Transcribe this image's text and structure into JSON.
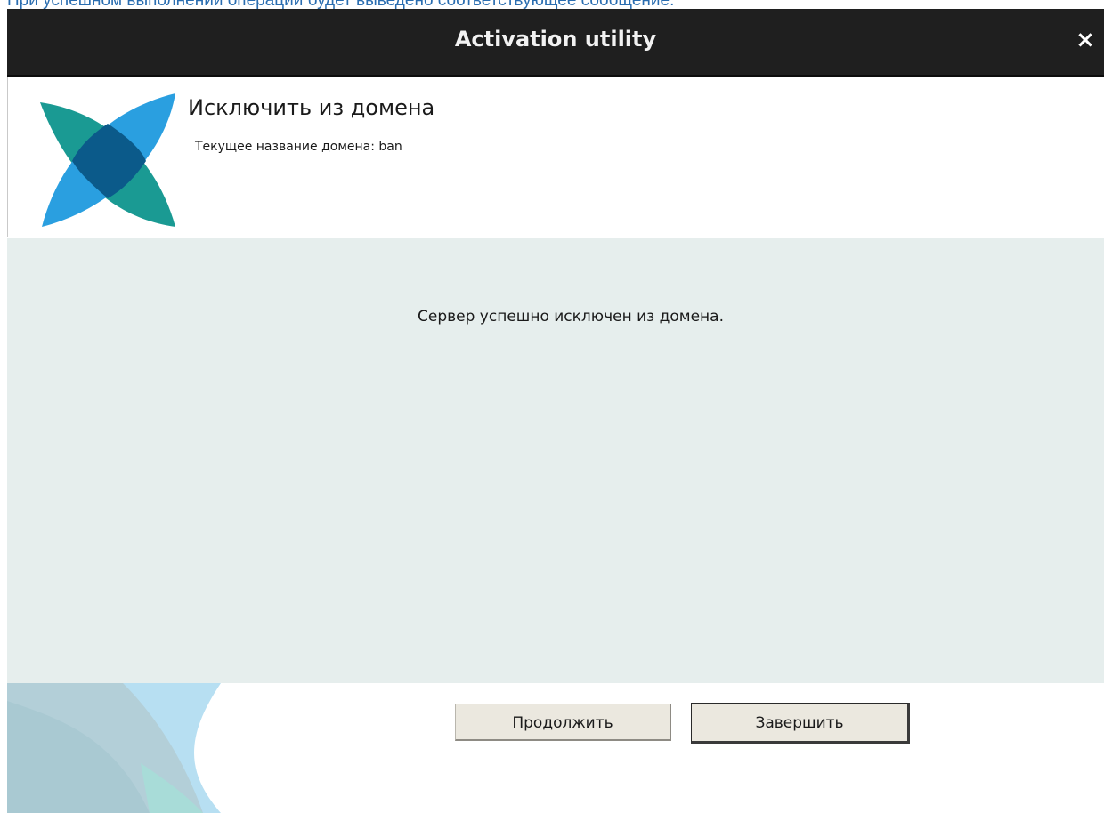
{
  "caption": "При успешном выполнении операции будет выведено соответствующее сообщение.",
  "window": {
    "title": "Activation utility",
    "close_glyph": "×"
  },
  "header": {
    "title": "Исключить из домена",
    "domain_label": "Текущее название домена: ban"
  },
  "content": {
    "message": "Сервер успешно исключен из домена."
  },
  "buttons": {
    "continue_label": "Продолжить",
    "finish_label": "Завершить"
  },
  "icons": {
    "logo": "app-logo-icon",
    "close": "close-icon",
    "footer_decoration": "footer-decoration-icon"
  },
  "colors": {
    "titlebar": "#1f1f1f",
    "content_bg": "#e6eeed",
    "logo_teal": "#1a9a93",
    "logo_blue": "#2a9fe0",
    "logo_overlap": "#0b5a8a",
    "caption_blue": "#2a6db0",
    "button_bg": "#ebe8df"
  }
}
